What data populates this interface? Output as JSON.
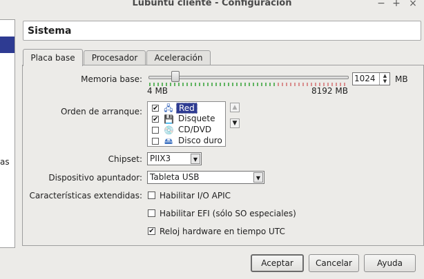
{
  "window": {
    "title": "Lubuntu cliente - Configuración",
    "controls": [
      "−",
      "+",
      "×"
    ]
  },
  "left_fragment": "as",
  "section_title": "Sistema",
  "tabs": [
    {
      "label": "Placa base",
      "active": true
    },
    {
      "label": "Procesador",
      "active": false
    },
    {
      "label": "Aceleración",
      "active": false
    }
  ],
  "motherboard": {
    "memory_label": "Memoria base:",
    "memory_value": "1024",
    "memory_unit": "MB",
    "memory_min": "4 MB",
    "memory_max": "8192 MB",
    "boot_order_label": "Orden de arranque:",
    "boot_items": [
      {
        "label": "Red",
        "checked": true,
        "icon": "network-icon"
      },
      {
        "label": "Disquete",
        "checked": true,
        "icon": "floppy-icon"
      },
      {
        "label": "CD/DVD",
        "checked": false,
        "icon": "cd-icon"
      },
      {
        "label": "Disco duro",
        "checked": false,
        "icon": "harddisk-icon"
      }
    ],
    "chipset_label": "Chipset:",
    "chipset_value": "PIIX3",
    "pointing_label": "Dispositivo apuntador:",
    "pointing_value": "Tableta USB",
    "extended_label": "Características extendidas:",
    "features": [
      {
        "label": "Habilitar I/O APIC",
        "checked": false
      },
      {
        "label": "Habilitar EFI (sólo SO especiales)",
        "checked": false
      },
      {
        "label": "Reloj hardware en tiempo UTC",
        "checked": true
      }
    ]
  },
  "buttons": {
    "accept": "Aceptar",
    "cancel": "Cancelar",
    "help": "Ayuda"
  },
  "colors": {
    "selection": "#2e3b92",
    "tick_green": "#5fb35f",
    "tick_red": "#d98d8d"
  }
}
